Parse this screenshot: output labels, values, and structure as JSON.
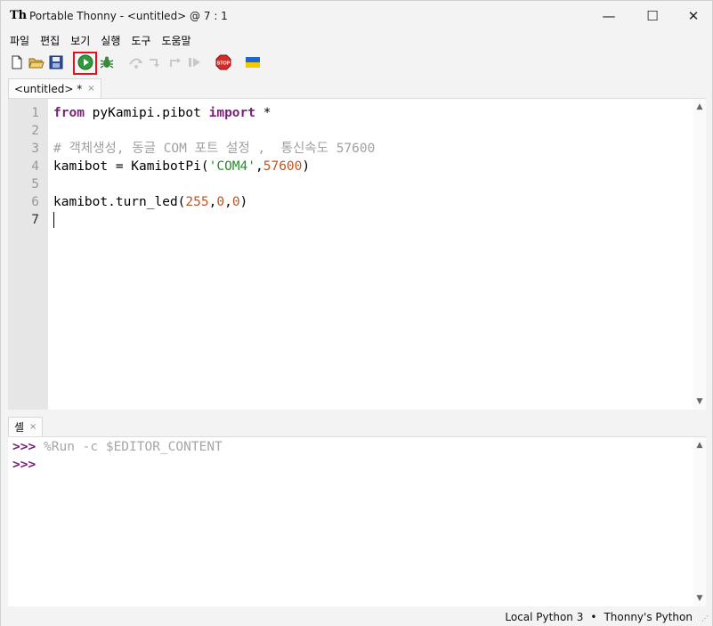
{
  "window": {
    "title": "Portable Thonny  -  <untitled>  @  7 : 1",
    "minimize": "—",
    "maximize": "☐",
    "close": "✕"
  },
  "menu": [
    "파일",
    "편집",
    "보기",
    "실행",
    "도구",
    "도움말"
  ],
  "toolbar": {
    "icons": [
      "new-file-icon",
      "open-file-icon",
      "save-icon",
      "run-icon",
      "debug-icon",
      "step-over-icon",
      "step-into-icon",
      "step-out-icon",
      "resume-icon",
      "stop-icon",
      "ukraine-flag-icon"
    ],
    "stop_label": "STOP",
    "highlight_color": "#e0141e"
  },
  "editor": {
    "tab_label": "<untitled> *",
    "tab_close": "×",
    "line_numbers": [
      "1",
      "2",
      "3",
      "4",
      "5",
      "6",
      "7"
    ],
    "lines": [
      {
        "kw1": "from",
        "text1": " pyKamipi.pibot ",
        "kw2": "import",
        "text2": " *"
      },
      {},
      {
        "comment": "# 객체생성, 동글 COM 포트 설정 ,  통신속도 57600"
      },
      {
        "pre": "kamibot = KamibotPi(",
        "str": "'COM4'",
        "comma": ",",
        "num": "57600",
        "post": ")"
      },
      {},
      {
        "pre": "kamibot.turn_led(",
        "n1": "255",
        "c1": ",",
        "n2": "0",
        "c2": ",",
        "n3": "0",
        "post": ")"
      },
      {}
    ]
  },
  "shell": {
    "tab_label": "셸",
    "tab_close": "×",
    "prompt": ">>>",
    "command": "%Run -c $EDITOR_CONTENT"
  },
  "status": {
    "interpreter": "Local Python 3",
    "separator": "•",
    "backend": "Thonny's Python",
    "grip": "⋰"
  },
  "colors": {
    "keyword": "#7a1f7a",
    "comment": "#a0a0a0",
    "string": "#2a8a2a",
    "number": "#c0551f"
  }
}
